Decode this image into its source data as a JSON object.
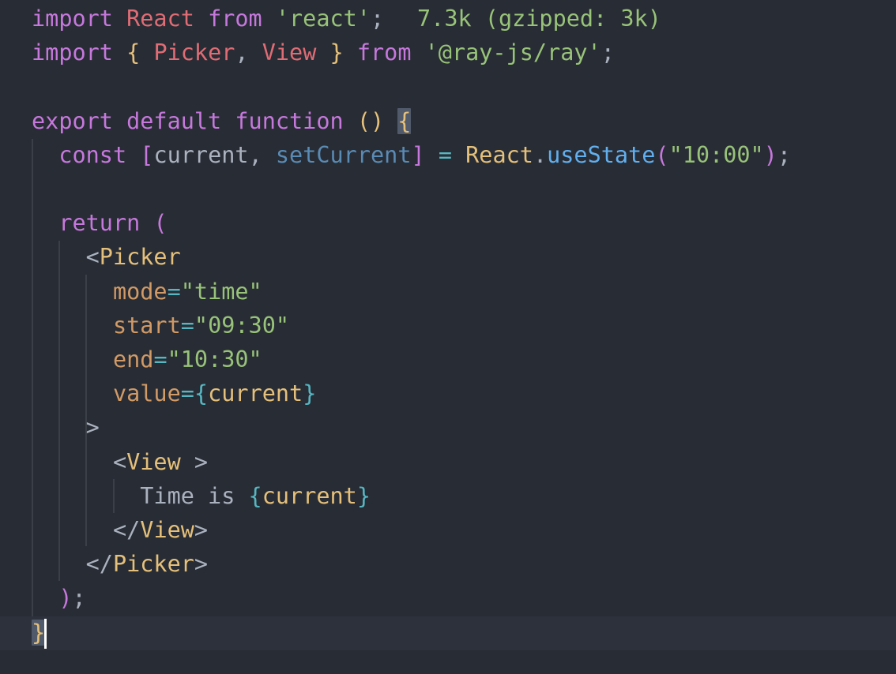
{
  "editor": {
    "import_hint": "7.3k (gzipped: 3k)",
    "lines": [
      [
        {
          "t": "import ",
          "c": "kw"
        },
        {
          "t": "React ",
          "c": "id"
        },
        {
          "t": "from ",
          "c": "kw"
        },
        {
          "t": "'react'",
          "c": "str"
        },
        {
          "t": ";",
          "c": "plain"
        }
      ],
      [
        {
          "t": "import ",
          "c": "kw"
        },
        {
          "t": "{ ",
          "c": "brace-y"
        },
        {
          "t": "Picker",
          "c": "id"
        },
        {
          "t": ", ",
          "c": "plain"
        },
        {
          "t": "View ",
          "c": "id"
        },
        {
          "t": "} ",
          "c": "brace-y"
        },
        {
          "t": "from ",
          "c": "kw"
        },
        {
          "t": "'@ray-js/ray'",
          "c": "str"
        },
        {
          "t": ";",
          "c": "plain"
        }
      ],
      [],
      [
        {
          "t": "export default function ",
          "c": "kw"
        },
        {
          "t": "() ",
          "c": "brace-y"
        },
        {
          "t": "{",
          "c": "brace-y",
          "m": "bracket-match"
        }
      ],
      [
        {
          "t": "  const ",
          "c": "kw"
        },
        {
          "t": "[",
          "c": "brace-p"
        },
        {
          "t": "current",
          "c": "plain"
        },
        {
          "t": ", ",
          "c": "plain"
        },
        {
          "t": "setCurrent",
          "c": "setter"
        },
        {
          "t": "] ",
          "c": "brace-p"
        },
        {
          "t": "= ",
          "c": "eq"
        },
        {
          "t": "React",
          "c": "tag"
        },
        {
          "t": ".",
          "c": "plain"
        },
        {
          "t": "useState",
          "c": "fn"
        },
        {
          "t": "(",
          "c": "brace-p"
        },
        {
          "t": "\"10:00\"",
          "c": "str"
        },
        {
          "t": ")",
          "c": "brace-p"
        },
        {
          "t": ";",
          "c": "plain"
        }
      ],
      [],
      [
        {
          "t": "  return ",
          "c": "kw"
        },
        {
          "t": "(",
          "c": "brace-p"
        }
      ],
      [
        {
          "t": "    <",
          "c": "plain"
        },
        {
          "t": "Picker",
          "c": "tag"
        }
      ],
      [
        {
          "t": "      mode",
          "c": "attr"
        },
        {
          "t": "=",
          "c": "eq"
        },
        {
          "t": "\"time\"",
          "c": "str"
        }
      ],
      [
        {
          "t": "      start",
          "c": "attr"
        },
        {
          "t": "=",
          "c": "eq"
        },
        {
          "t": "\"09:30\"",
          "c": "str"
        }
      ],
      [
        {
          "t": "      end",
          "c": "attr"
        },
        {
          "t": "=",
          "c": "eq"
        },
        {
          "t": "\"10:30\"",
          "c": "str"
        }
      ],
      [
        {
          "t": "      value",
          "c": "attr"
        },
        {
          "t": "=",
          "c": "eq"
        },
        {
          "t": "{",
          "c": "brace-b"
        },
        {
          "t": "current",
          "c": "tag"
        },
        {
          "t": "}",
          "c": "brace-b"
        }
      ],
      [
        {
          "t": "    >",
          "c": "plain"
        }
      ],
      [
        {
          "t": "      <",
          "c": "plain"
        },
        {
          "t": "View ",
          "c": "tag"
        },
        {
          "t": ">",
          "c": "plain"
        }
      ],
      [
        {
          "t": "        Time is ",
          "c": "plain"
        },
        {
          "t": "{",
          "c": "brace-b"
        },
        {
          "t": "current",
          "c": "tag"
        },
        {
          "t": "}",
          "c": "brace-b"
        }
      ],
      [
        {
          "t": "      </",
          "c": "plain"
        },
        {
          "t": "View",
          "c": "tag"
        },
        {
          "t": ">",
          "c": "plain"
        }
      ],
      [
        {
          "t": "    </",
          "c": "plain"
        },
        {
          "t": "Picker",
          "c": "tag"
        },
        {
          "t": ">",
          "c": "plain"
        }
      ],
      [
        {
          "t": "  )",
          "c": "brace-p"
        },
        {
          "t": ";",
          "c": "plain"
        }
      ],
      [
        {
          "t": "}",
          "c": "brace-y",
          "m": "bracket-match"
        }
      ]
    ]
  }
}
